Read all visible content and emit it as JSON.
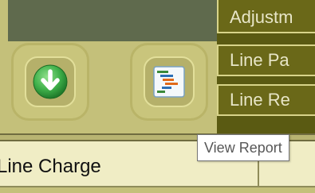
{
  "menu": {
    "items": [
      {
        "label": "Adjustm"
      },
      {
        "label": "Line Pa"
      },
      {
        "label": "Line Re"
      }
    ]
  },
  "actions": {
    "download_icon": "download-arrow-icon",
    "report_icon": "gantt-report-icon"
  },
  "tooltip": {
    "text": "View Report"
  },
  "grid": {
    "cell_text": "Line Charge"
  },
  "colors": {
    "panel": "#c4c07a",
    "menu_bg": "#6a6818",
    "menu_text": "#e8e6c8",
    "download_green": "#3fb04a",
    "grid_row": "#f0edc5"
  }
}
